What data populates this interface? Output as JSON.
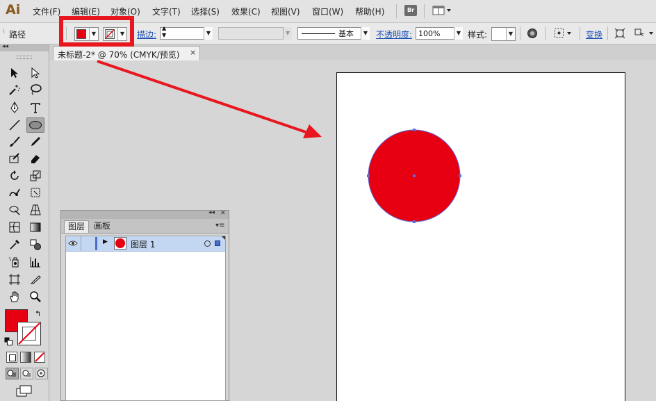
{
  "app": {
    "logo": "Ai",
    "menus": [
      "文件(F)",
      "编辑(E)",
      "对象(O)",
      "文字(T)",
      "选择(S)",
      "效果(C)",
      "视图(V)",
      "窗口(W)",
      "帮助(H)"
    ],
    "bridge_label": "Br"
  },
  "control_bar": {
    "selection_label": "路径",
    "fill_color": "#e60012",
    "stroke_label": "描边:",
    "stroke_profile": "基本",
    "opacity_label": "不透明度:",
    "opacity_value": "100%",
    "style_label": "样式:",
    "transform_label": "变换"
  },
  "document_tab": {
    "title": "未标题-2* @ 70% (CMYK/预览)",
    "close_glyph": "×"
  },
  "toolbox": {
    "collapse_glyph": "◂◂",
    "fill_color": "#e60012"
  },
  "layers_panel": {
    "collapse_glyph": "◂◂",
    "close_glyph": "✕",
    "tabs": [
      "图层",
      "画板"
    ],
    "layers": [
      {
        "name": "图层 1",
        "thumb_color": "#e60012",
        "highlight": "#c4d7f2"
      }
    ]
  },
  "artboard": {
    "shape_fill": "#e60012",
    "selection_color": "#5a6ad8"
  },
  "annotation": {
    "color": "#e8161e"
  }
}
